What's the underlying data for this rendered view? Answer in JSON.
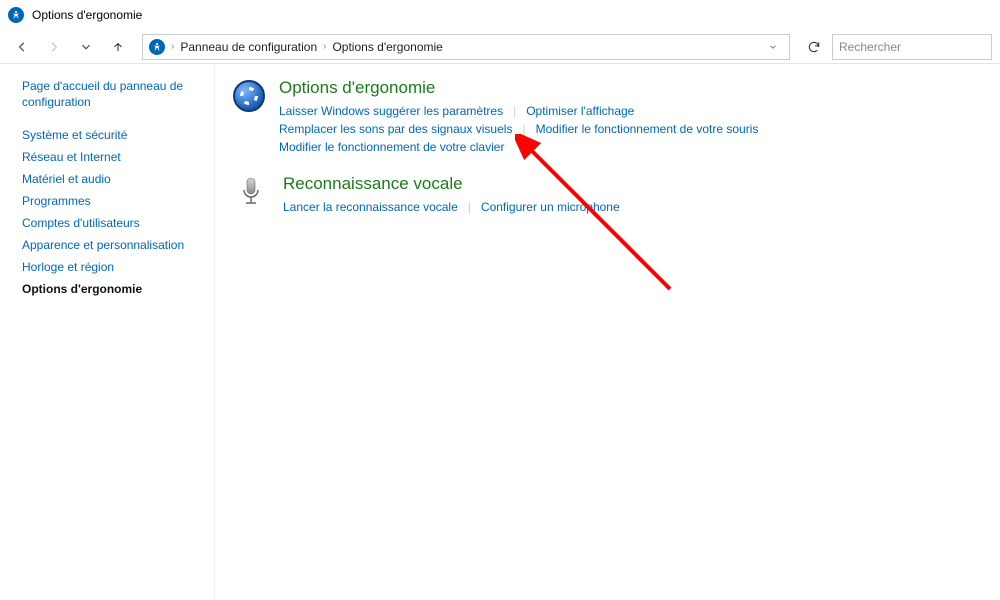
{
  "window": {
    "title": "Options d'ergonomie"
  },
  "breadcrumb": {
    "root": "Panneau de configuration",
    "current": "Options d'ergonomie"
  },
  "search": {
    "placeholder": "Rechercher"
  },
  "sidebar": {
    "home": "Page d'accueil du panneau de configuration",
    "items": [
      {
        "label": "Système et sécurité"
      },
      {
        "label": "Réseau et Internet"
      },
      {
        "label": "Matériel et audio"
      },
      {
        "label": "Programmes"
      },
      {
        "label": "Comptes d'utilisateurs"
      },
      {
        "label": "Apparence et personnalisation"
      },
      {
        "label": "Horloge et région"
      },
      {
        "label": "Options d'ergonomie",
        "active": true
      }
    ]
  },
  "sections": [
    {
      "title": "Options d'ergonomie",
      "links": [
        "Laisser Windows suggérer les paramètres",
        "Optimiser l'affichage",
        "Remplacer les sons par des signaux visuels",
        "Modifier le fonctionnement de votre souris",
        "Modifier le fonctionnement de votre clavier"
      ]
    },
    {
      "title": "Reconnaissance vocale",
      "links": [
        "Lancer la reconnaissance vocale",
        "Configurer un microphone"
      ]
    }
  ]
}
